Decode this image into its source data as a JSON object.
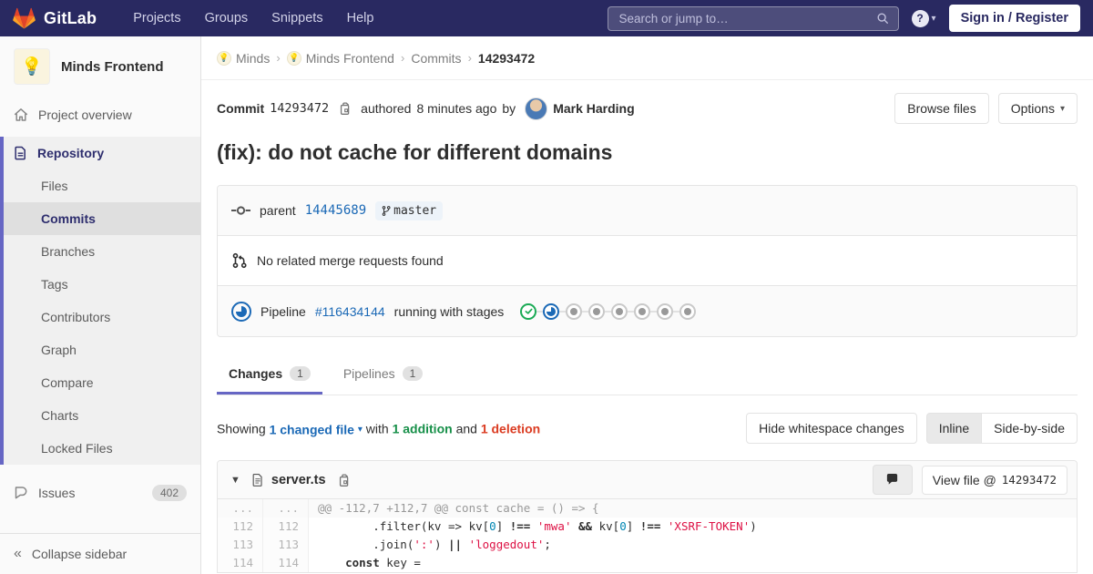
{
  "navbar": {
    "brand": "GitLab",
    "menu": [
      "Projects",
      "Groups",
      "Snippets",
      "Help"
    ],
    "search_placeholder": "Search or jump to…",
    "sign_in": "Sign in / Register"
  },
  "sidebar": {
    "project_name": "Minds Frontend",
    "project_avatar": "💡",
    "overview": "Project overview",
    "repository": {
      "label": "Repository",
      "items": [
        "Files",
        "Commits",
        "Branches",
        "Tags",
        "Contributors",
        "Graph",
        "Compare",
        "Charts",
        "Locked Files"
      ],
      "active_item": "Commits"
    },
    "issues": {
      "label": "Issues",
      "count": "402"
    },
    "collapse": "Collapse sidebar"
  },
  "breadcrumb": {
    "items": [
      {
        "label": "Minds",
        "avatar": "💡"
      },
      {
        "label": "Minds Frontend",
        "avatar": "💡"
      },
      {
        "label": "Commits"
      },
      {
        "label": "14293472"
      }
    ]
  },
  "commit": {
    "label": "Commit",
    "sha": "14293472",
    "authored": "authored",
    "time_ago": "8 minutes ago",
    "by": "by",
    "author": "Mark Harding",
    "browse_files": "Browse files",
    "options": "Options",
    "title": "(fix): do not cache for different domains",
    "parent_label": "parent",
    "parent_sha": "14445689",
    "branch": "master",
    "no_mr": "No related merge requests found",
    "pipeline": {
      "label": "Pipeline",
      "id": "#116434144",
      "status_text": "running with stages",
      "stages": [
        "success",
        "running",
        "created",
        "created",
        "created",
        "created",
        "created",
        "created"
      ]
    }
  },
  "tabs": [
    {
      "label": "Changes",
      "count": "1",
      "active": true
    },
    {
      "label": "Pipelines",
      "count": "1",
      "active": false
    }
  ],
  "diff_bar": {
    "showing": "Showing",
    "changed": "1 changed file",
    "with": "with",
    "additions": "1 addition",
    "and": "and",
    "deletions": "1 deletion",
    "hide_whitespace": "Hide whitespace changes",
    "inline": "Inline",
    "side_by_side": "Side-by-side"
  },
  "file": {
    "name": "server.ts",
    "view_file_prefix": "View file @",
    "view_file_sha": "14293472",
    "lines": [
      {
        "old": "...",
        "new": "...",
        "kind": "match",
        "tokens": [
          [
            "m",
            "@@ -112,7 +112,7 @@ const cache = () => {"
          ]
        ]
      },
      {
        "old": "112",
        "new": "112",
        "kind": "context",
        "tokens": [
          [
            "p",
            "        .filter(kv => kv["
          ],
          [
            "n",
            "0"
          ],
          [
            "p",
            "] "
          ],
          [
            "o",
            "!=="
          ],
          [
            "p",
            " "
          ],
          [
            "s",
            "'mwa'"
          ],
          [
            "p",
            " "
          ],
          [
            "o",
            "&&"
          ],
          [
            "p",
            " kv["
          ],
          [
            "n",
            "0"
          ],
          [
            "p",
            "] "
          ],
          [
            "o",
            "!=="
          ],
          [
            "p",
            " "
          ],
          [
            "s",
            "'XSRF-TOKEN'"
          ],
          [
            "p",
            ")"
          ]
        ]
      },
      {
        "old": "113",
        "new": "113",
        "kind": "context",
        "tokens": [
          [
            "p",
            "        .join("
          ],
          [
            "s",
            "':'"
          ],
          [
            "p",
            ") "
          ],
          [
            "o",
            "||"
          ],
          [
            "p",
            " "
          ],
          [
            "s",
            "'loggedout'"
          ],
          [
            "p",
            ";"
          ]
        ]
      },
      {
        "old": "114",
        "new": "114",
        "kind": "context",
        "tokens": [
          [
            "p",
            "    "
          ],
          [
            "k",
            "const"
          ],
          [
            "p",
            " key ="
          ]
        ]
      }
    ]
  },
  "colors": {
    "navbar_bg": "#292961",
    "accent": "#6666c4",
    "link": "#1b69b6",
    "success": "#1aaa55",
    "running": "#1b69b6",
    "addition_green": "#168f48",
    "deletion_red": "#db3b21",
    "code_string": "#dd1144",
    "code_number": "#0086b3"
  }
}
